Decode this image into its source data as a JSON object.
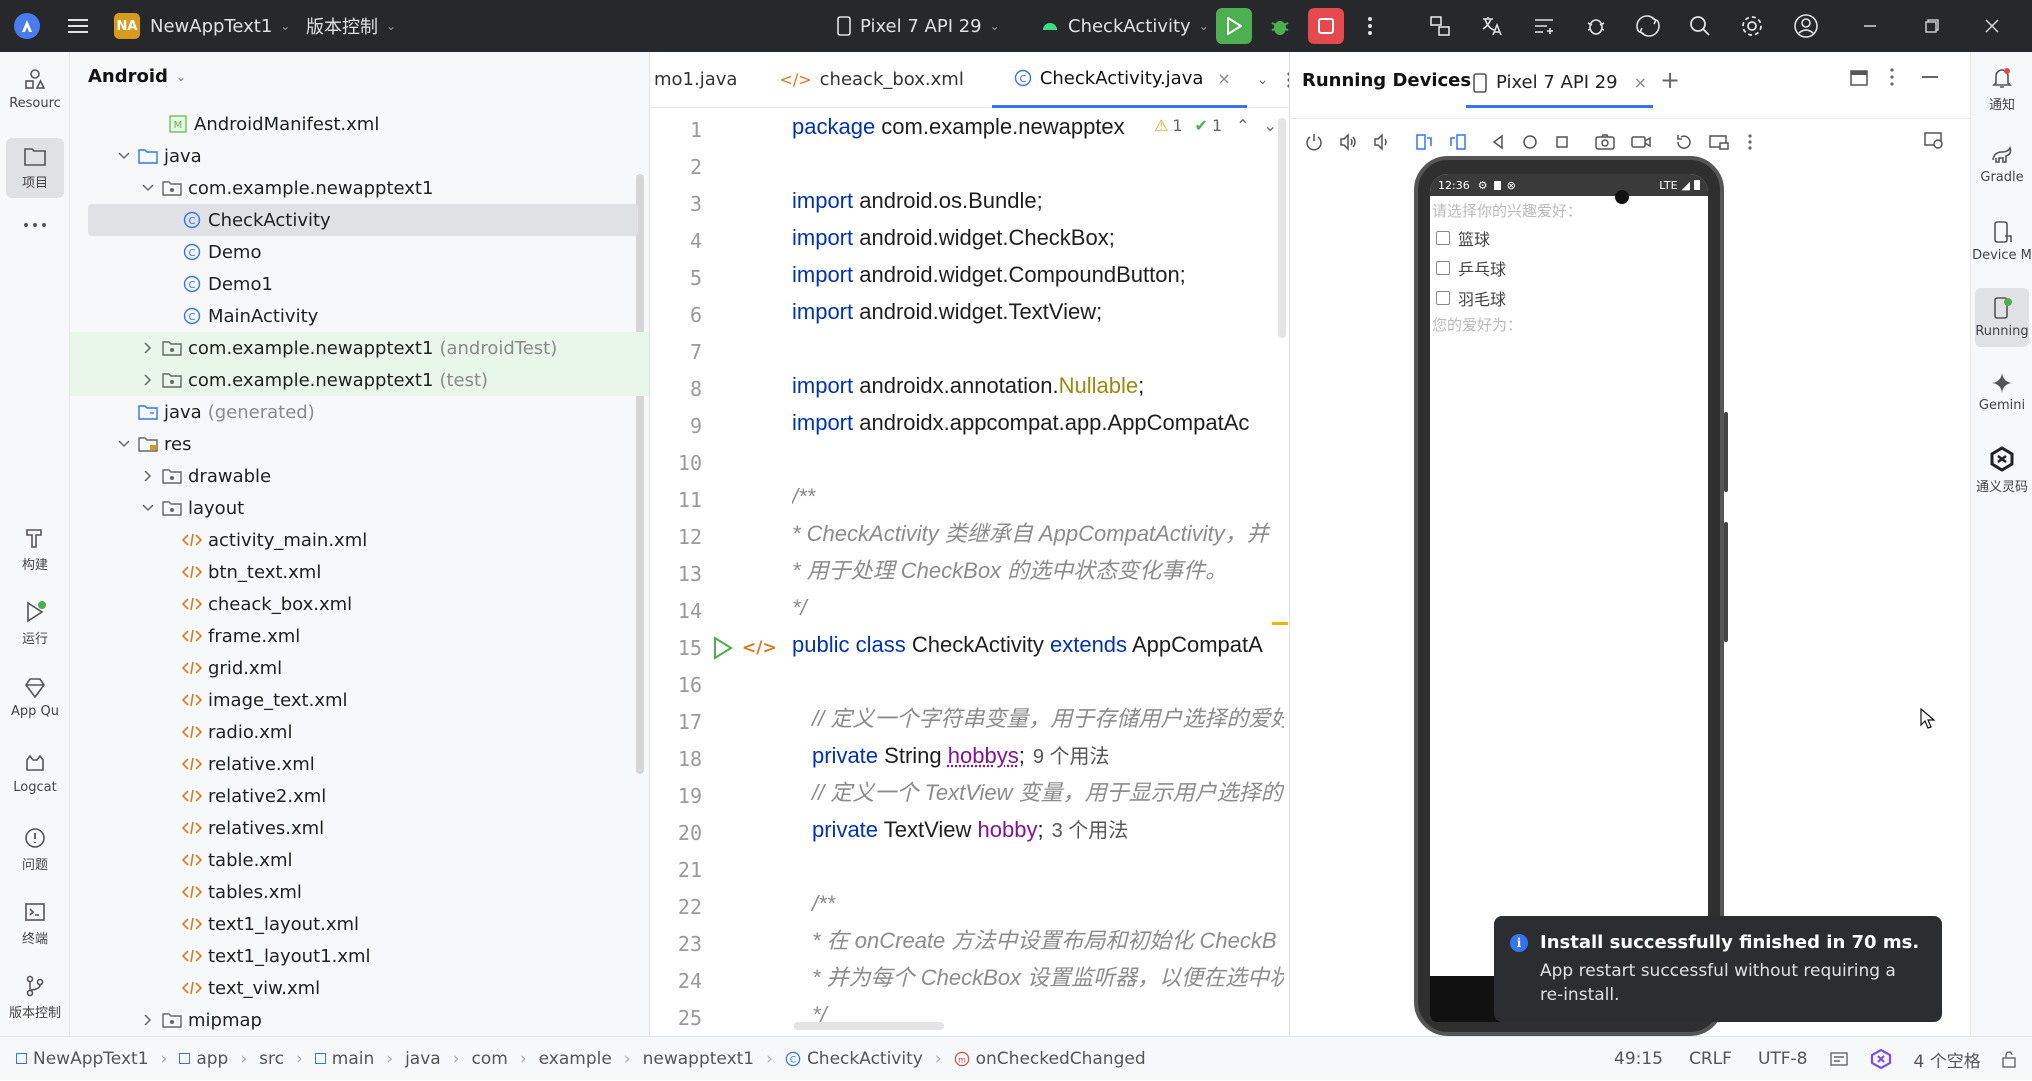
{
  "titlebar": {
    "project_badge": "NA",
    "project_name": "NewAppText1",
    "vcs": "版本控制",
    "device": "Pixel 7 API 29",
    "run_config": "CheckActivity"
  },
  "left_strip": {
    "resource_manager": "Resourc",
    "project": "项目",
    "build": "构建",
    "run": "运行",
    "app_quality": "App Qu",
    "logcat": "Logcat",
    "problems": "问题",
    "terminal": "终端",
    "vcs": "版本控制"
  },
  "project_panel": {
    "view_mode": "Android",
    "rows": [
      {
        "label": "AndroidManifest.xml",
        "suffix": ""
      },
      {
        "label": "java",
        "suffix": ""
      },
      {
        "label": "com.example.newapptext1",
        "suffix": ""
      },
      {
        "label": "CheckActivity",
        "suffix": ""
      },
      {
        "label": "Demo",
        "suffix": ""
      },
      {
        "label": "Demo1",
        "suffix": ""
      },
      {
        "label": "MainActivity",
        "suffix": ""
      },
      {
        "label": "com.example.newapptext1",
        "suffix": "(androidTest)"
      },
      {
        "label": "com.example.newapptext1",
        "suffix": "(test)"
      },
      {
        "label": "java",
        "suffix": "(generated)"
      },
      {
        "label": "res",
        "suffix": ""
      },
      {
        "label": "drawable",
        "suffix": ""
      },
      {
        "label": "layout",
        "suffix": ""
      },
      {
        "label": "activity_main.xml",
        "suffix": ""
      },
      {
        "label": "btn_text.xml",
        "suffix": ""
      },
      {
        "label": "cheack_box.xml",
        "suffix": ""
      },
      {
        "label": "frame.xml",
        "suffix": ""
      },
      {
        "label": "grid.xml",
        "suffix": ""
      },
      {
        "label": "image_text.xml",
        "suffix": ""
      },
      {
        "label": "radio.xml",
        "suffix": ""
      },
      {
        "label": "relative.xml",
        "suffix": ""
      },
      {
        "label": "relative2.xml",
        "suffix": ""
      },
      {
        "label": "relatives.xml",
        "suffix": ""
      },
      {
        "label": "table.xml",
        "suffix": ""
      },
      {
        "label": "tables.xml",
        "suffix": ""
      },
      {
        "label": "text1_layout.xml",
        "suffix": ""
      },
      {
        "label": "text1_layout1.xml",
        "suffix": ""
      },
      {
        "label": "text_viw.xml",
        "suffix": ""
      },
      {
        "label": "mipmap",
        "suffix": ""
      }
    ]
  },
  "editor": {
    "tabs": [
      "mo1.java",
      "cheack_box.xml",
      "CheckActivity.java"
    ],
    "inspection_warnings": "1",
    "inspection_ok": "1",
    "line_numbers": [
      "1",
      "2",
      "3",
      "4",
      "5",
      "6",
      "7",
      "8",
      "9",
      "10",
      "11",
      "12",
      "13",
      "14",
      "15",
      "16",
      "17",
      "18",
      "19",
      "20",
      "21",
      "22",
      "23",
      "24",
      "25"
    ],
    "code": {
      "l1_kw": "package",
      "l1_rest": " com.example.newapptex",
      "l3_kw": "import",
      "l3_rest": " android.os.Bundle;",
      "l4_kw": "import",
      "l4_rest": " android.widget.CheckBox;",
      "l5_kw": "import",
      "l5_rest": " android.widget.CompoundButton;",
      "l6_kw": "import",
      "l6_rest": " android.widget.TextView;",
      "l8_kw": "import",
      "l8_rest": " androidx.annotation.",
      "l8_ann": "Nullable",
      "l8_end": ";",
      "l9_kw": "import",
      "l9_rest": " androidx.appcompat.app.AppCompatAc",
      "l11": "/**",
      "l12": " * CheckActivity 类继承自 AppCompatActivity，并",
      "l13": " * 用于处理 CheckBox 的选中状态变化事件。",
      "l14": " */",
      "l15_kw1": "public class",
      "l15_name": " CheckActivity  ",
      "l15_kw2": "extends",
      "l15_rest": " AppCompatA",
      "l17": "// 定义一个字符串变量，用于存储用户选择的爱好",
      "l18_kw": "private",
      "l18_type": " String ",
      "l18_field": "hobbys",
      "l18_end": ";",
      "l18_hint": "9 个用法",
      "l19": "// 定义一个 TextView 变量，用于显示用户选择的",
      "l20_kw": "private",
      "l20_type": " TextView ",
      "l20_field": "hobby",
      "l20_end": ";",
      "l20_hint": "3 个用法",
      "l22": "/**",
      "l23": " * 在 onCreate 方法中设置布局和初始化 CheckB",
      "l24": " * 并为每个 CheckBox 设置监听器，以便在选中状",
      "l25": " */"
    }
  },
  "devices": {
    "title": "Running Devices",
    "device_tab": "Pixel 7 API 29",
    "phone": {
      "time": "12:36",
      "network": "LTE",
      "prompt": "请选择你的兴趣爱好：",
      "options": [
        "篮球",
        "乒乓球",
        "羽毛球"
      ],
      "result": "您的爱好为："
    },
    "toast": {
      "title": "Install successfully finished in 70 ms.",
      "body": "App restart successful without requiring a re-install."
    }
  },
  "right_strip": {
    "notifications": "通知",
    "gradle": "Gradle",
    "device_manager": "Device M",
    "running": "Running",
    "gemini": "Gemini",
    "tongyi": "通义灵码"
  },
  "statusbar": {
    "breadcrumbs": [
      "NewAppText1",
      "app",
      "src",
      "main",
      "java",
      "com",
      "example",
      "newapptext1",
      "CheckActivity",
      "onCheckedChanged"
    ],
    "position": "49:15",
    "line_sep": "CRLF",
    "encoding": "UTF-8",
    "indent": "4 个空格"
  },
  "colors": {
    "titlebar_bg": "#27282c",
    "accent": "#3574f0",
    "run_green": "#4caf50",
    "stop_red": "#e5484d",
    "toast_bg": "#2b2d30"
  }
}
